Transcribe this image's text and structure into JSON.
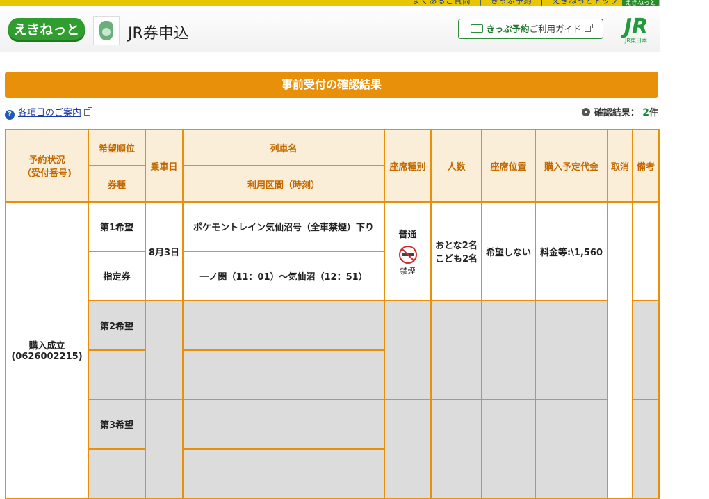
{
  "header": {
    "logo_text": "えきねっと",
    "app_title": "JR券申込",
    "guide_button_strong": "きっぷ予約",
    "guide_button_rest": "ご利用ガイド",
    "jr_logo": "JR",
    "jr_logo_sub": "JR東日本"
  },
  "section_title": "事前受付の確認結果",
  "info": {
    "help_link": "各項目のご案内",
    "result_label": "確認結果：",
    "result_count": "2",
    "result_unit": "件"
  },
  "table": {
    "headers": {
      "status": "予約状況\n（受付番号)",
      "priority": "希望順位",
      "ticket_type": "券種",
      "date": "乗車日",
      "train_name": "列車名",
      "route": "利用区間（時刻）",
      "seat_class": "座席種別",
      "people": "人数",
      "seat_position": "座席位置",
      "price": "購入予定代金",
      "cancel": "取消",
      "remarks": "備考"
    },
    "status": {
      "label": "購入成立",
      "number": "(0626002215)"
    },
    "rows": [
      {
        "priority": "第1希望",
        "ticket_type": "指定券",
        "date": "8月3日",
        "train_name": "ポケモントレイン気仙沼号（全車禁煙）下り",
        "route": "一ノ関（11：01）〜気仙沼（12：51）",
        "seat_class": "普通",
        "smoking": "禁煙",
        "people_adult": "おとな2名",
        "people_child": "こども2名",
        "seat_position": "希望しない",
        "price": "料金等:\\1,560"
      },
      {
        "priority": "第2希望"
      },
      {
        "priority": "第3希望"
      }
    ]
  },
  "colors": {
    "accent_orange": "#e8900a",
    "header_bg": "#fbeed8",
    "brand_green": "#2f9e2f"
  }
}
